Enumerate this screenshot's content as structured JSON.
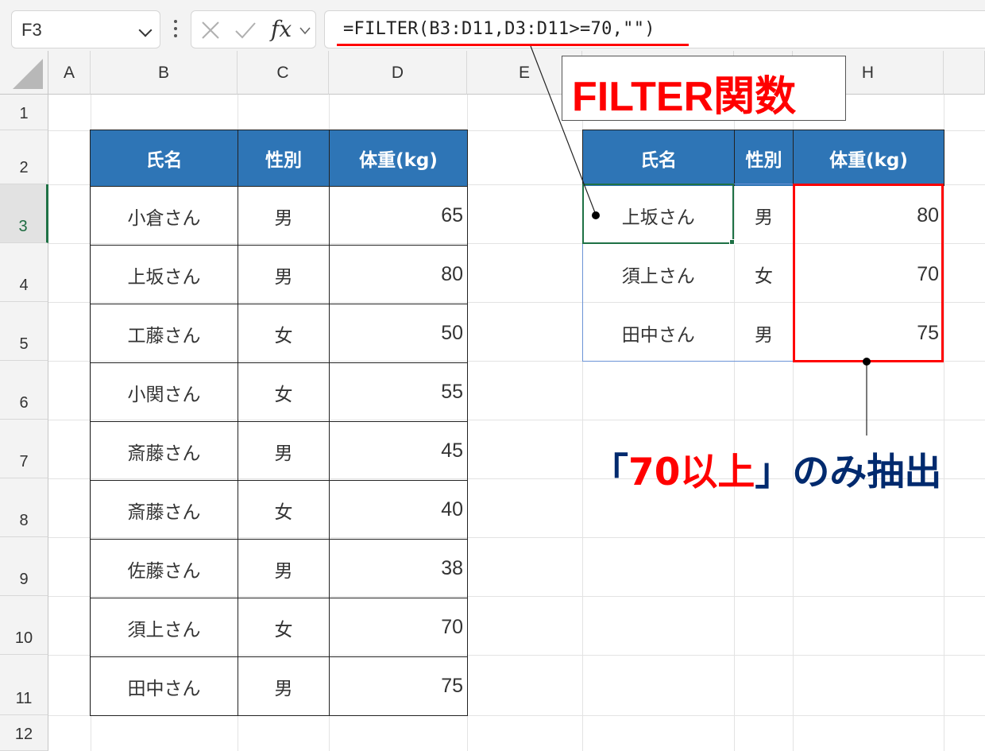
{
  "formula_bar": {
    "name_box": "F3",
    "fx_label": "fx",
    "formula": "=FILTER(B3:D11,D3:D11>=70,\"\")"
  },
  "columns": [
    "A",
    "B",
    "C",
    "D",
    "E",
    "H"
  ],
  "rows": [
    "1",
    "2",
    "3",
    "4",
    "5",
    "6",
    "7",
    "8",
    "9",
    "10",
    "11",
    "12"
  ],
  "source_table": {
    "headers": [
      "氏名",
      "性別",
      "体重(kg)"
    ],
    "rows": [
      [
        "小倉さん",
        "男",
        "65"
      ],
      [
        "上坂さん",
        "男",
        "80"
      ],
      [
        "工藤さん",
        "女",
        "50"
      ],
      [
        "小関さん",
        "女",
        "55"
      ],
      [
        "斎藤さん",
        "男",
        "45"
      ],
      [
        "斎藤さん",
        "女",
        "40"
      ],
      [
        "佐藤さん",
        "男",
        "38"
      ],
      [
        "須上さん",
        "女",
        "70"
      ],
      [
        "田中さん",
        "男",
        "75"
      ]
    ]
  },
  "result_table": {
    "headers": [
      "氏名",
      "性別",
      "体重(kg)"
    ],
    "rows": [
      [
        "上坂さん",
        "男",
        "80"
      ],
      [
        "須上さん",
        "女",
        "70"
      ],
      [
        "田中さん",
        "男",
        "75"
      ]
    ]
  },
  "annotations": {
    "function_callout": "FILTER関数",
    "extract_open": "「",
    "extract_highlight": "70以上",
    "extract_rest": "」のみ抽出"
  },
  "colors": {
    "header_fill": "#2e75b6",
    "highlight_red": "#ff0000",
    "annotation_navy": "#002a6e",
    "selection_green": "#1e7145"
  }
}
